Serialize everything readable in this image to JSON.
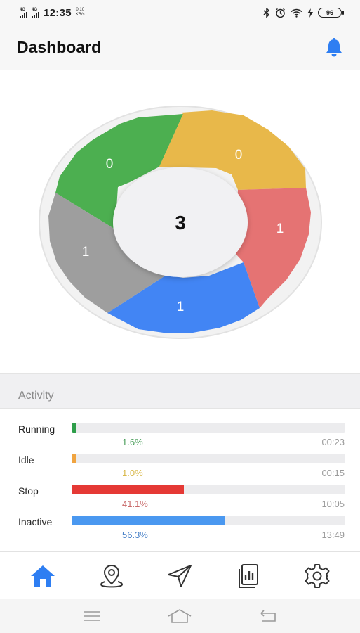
{
  "status_bar": {
    "network_1": "4G",
    "network_2": "4G",
    "time": "12:35",
    "speed_value": "0.10",
    "speed_unit": "KB/s",
    "icons": [
      "bluetooth-icon",
      "alarm-icon",
      "wifi-icon",
      "charging-icon"
    ],
    "battery": "96"
  },
  "header": {
    "title": "Dashboard",
    "icon": "bell-icon",
    "accent": "#2e7ef2"
  },
  "donut": {
    "center_value": "3",
    "segments": [
      {
        "key": "green",
        "value": "0",
        "color": "#4caf50"
      },
      {
        "key": "yellow",
        "value": "0",
        "color": "#e8b84a"
      },
      {
        "key": "red",
        "value": "1",
        "color": "#e57373"
      },
      {
        "key": "blue",
        "value": "1",
        "color": "#4285f4"
      },
      {
        "key": "gray",
        "value": "1",
        "color": "#9e9e9e"
      }
    ]
  },
  "activity": {
    "heading": "Activity",
    "rows": [
      {
        "label": "Running",
        "percent_text": "1.6%",
        "fraction": 0.016,
        "time": "00:23",
        "color": "#2e9e4a",
        "text_color": "#4a9e5a"
      },
      {
        "label": "Idle",
        "percent_text": "1.0%",
        "fraction": 0.01,
        "time": "00:15",
        "color": "#f0a440",
        "text_color": "#d8b84a"
      },
      {
        "label": "Stop",
        "percent_text": "41.1%",
        "fraction": 0.411,
        "time": "10:05",
        "color": "#e53935",
        "text_color": "#c96a6a"
      },
      {
        "label": "Inactive",
        "percent_text": "56.3%",
        "fraction": 0.563,
        "time": "13:49",
        "color": "#4a98f0",
        "text_color": "#4a82c8"
      }
    ]
  },
  "bottom_nav": {
    "items": [
      {
        "name": "home-icon",
        "active": true
      },
      {
        "name": "location-pin-icon",
        "active": false
      },
      {
        "name": "navigation-arrow-icon",
        "active": false
      },
      {
        "name": "report-icon",
        "active": false
      },
      {
        "name": "settings-gear-icon",
        "active": false
      }
    ],
    "active_color": "#2e7ef2",
    "inactive_color": "#333333"
  },
  "system_nav": {
    "items": [
      "menu-icon",
      "home-outline-icon",
      "back-icon"
    ]
  }
}
